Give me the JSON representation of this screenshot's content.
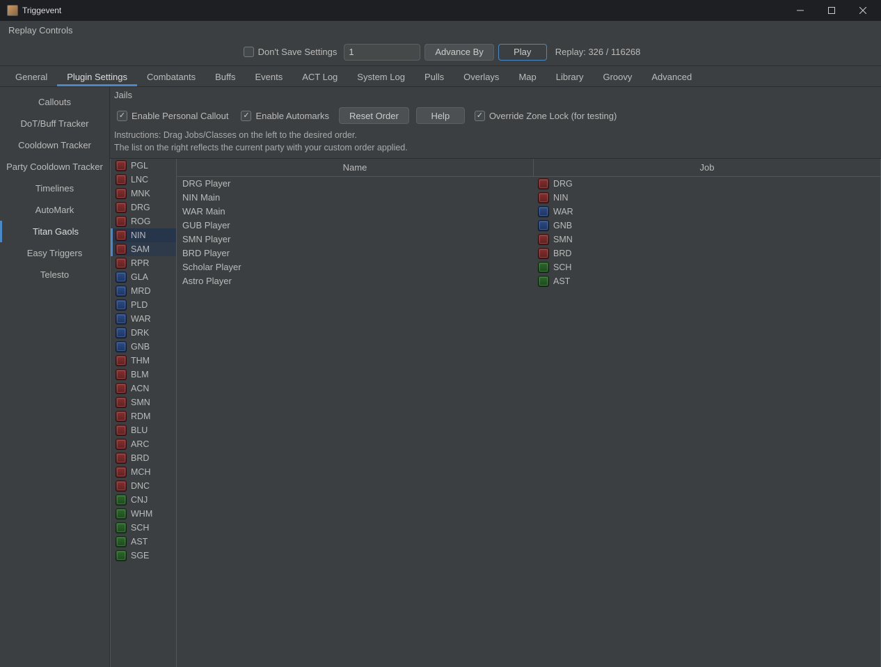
{
  "window": {
    "title": "Triggevent"
  },
  "replay": {
    "panel_label": "Replay Controls",
    "dont_save_label": "Don't Save Settings",
    "dont_save_checked": false,
    "input_value": "1",
    "advance_label": "Advance By",
    "play_label": "Play",
    "status": "Replay: 326 / 116268"
  },
  "tabs": [
    "General",
    "Plugin Settings",
    "Combatants",
    "Buffs",
    "Events",
    "ACT Log",
    "System Log",
    "Pulls",
    "Overlays",
    "Map",
    "Library",
    "Groovy",
    "Advanced"
  ],
  "active_tab": 1,
  "side_nav": [
    "Callouts",
    "DoT/Buff Tracker",
    "Cooldown Tracker",
    "Party Cooldown Tracker",
    "Timelines",
    "AutoMark",
    "Titan Gaols",
    "Easy Triggers",
    "Telesto"
  ],
  "active_side": 6,
  "jails": {
    "title": "Jails",
    "checkbox_personal": "Enable Personal Callout",
    "checkbox_automarks": "Enable Automarks",
    "btn_reset": "Reset Order",
    "btn_help": "Help",
    "checkbox_override": "Override Zone Lock (for testing)",
    "personal_checked": true,
    "automarks_checked": true,
    "override_checked": true,
    "instructions_1": "Instructions: Drag Jobs/Classes on the left to the desired order.",
    "instructions_2": "The list on the right reflects the current party with your custom order applied."
  },
  "party_header": {
    "name": "Name",
    "job": "Job"
  },
  "job_order": [
    {
      "code": "PGL",
      "role": "melee"
    },
    {
      "code": "LNC",
      "role": "melee"
    },
    {
      "code": "MNK",
      "role": "melee"
    },
    {
      "code": "DRG",
      "role": "melee"
    },
    {
      "code": "ROG",
      "role": "melee"
    },
    {
      "code": "NIN",
      "role": "melee",
      "sel": "sel1"
    },
    {
      "code": "SAM",
      "role": "melee",
      "sel": "sel2"
    },
    {
      "code": "RPR",
      "role": "melee"
    },
    {
      "code": "GLA",
      "role": "tank"
    },
    {
      "code": "MRD",
      "role": "tank"
    },
    {
      "code": "PLD",
      "role": "tank"
    },
    {
      "code": "WAR",
      "role": "tank"
    },
    {
      "code": "DRK",
      "role": "tank"
    },
    {
      "code": "GNB",
      "role": "tank"
    },
    {
      "code": "THM",
      "role": "caster"
    },
    {
      "code": "BLM",
      "role": "caster"
    },
    {
      "code": "ACN",
      "role": "caster"
    },
    {
      "code": "SMN",
      "role": "caster"
    },
    {
      "code": "RDM",
      "role": "caster"
    },
    {
      "code": "BLU",
      "role": "caster"
    },
    {
      "code": "ARC",
      "role": "ranged"
    },
    {
      "code": "BRD",
      "role": "ranged"
    },
    {
      "code": "MCH",
      "role": "ranged"
    },
    {
      "code": "DNC",
      "role": "ranged"
    },
    {
      "code": "CNJ",
      "role": "healer"
    },
    {
      "code": "WHM",
      "role": "healer"
    },
    {
      "code": "SCH",
      "role": "healer"
    },
    {
      "code": "AST",
      "role": "healer"
    },
    {
      "code": "SGE",
      "role": "healer"
    }
  ],
  "party": [
    {
      "name": "DRG Player",
      "job": "DRG",
      "role": "melee"
    },
    {
      "name": "NIN Main",
      "job": "NIN",
      "role": "melee"
    },
    {
      "name": "WAR Main",
      "job": "WAR",
      "role": "tank"
    },
    {
      "name": "GUB Player",
      "job": "GNB",
      "role": "tank"
    },
    {
      "name": "SMN Player",
      "job": "SMN",
      "role": "caster"
    },
    {
      "name": "BRD Player",
      "job": "BRD",
      "role": "ranged"
    },
    {
      "name": "Scholar Player",
      "job": "SCH",
      "role": "healer"
    },
    {
      "name": "Astro Player",
      "job": "AST",
      "role": "healer"
    }
  ]
}
